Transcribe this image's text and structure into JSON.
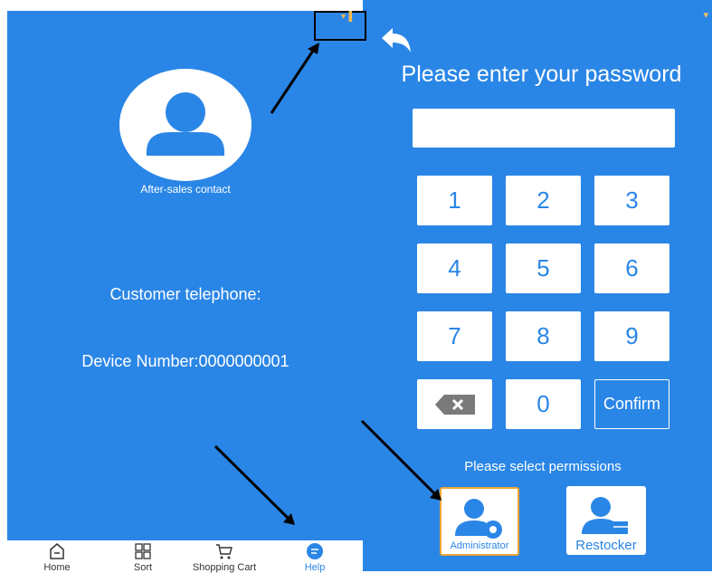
{
  "left": {
    "contact_label": "After-sales contact",
    "telephone_label": "Customer telephone:",
    "device_label": "Device Number:0000000001"
  },
  "right": {
    "title": "Please enter your password",
    "password_value": "",
    "keys": [
      "1",
      "2",
      "3",
      "4",
      "5",
      "6",
      "7",
      "8",
      "9",
      "0"
    ],
    "confirm_label": "Confirm",
    "permissions_title": "Please select permissions",
    "admin_label": "Administrator",
    "restocker_label": "Restocker"
  },
  "nav": {
    "home": "Home",
    "sort": "Sort",
    "cart": "Shopping Cart",
    "help": "Help"
  },
  "colors": {
    "background": "#2a86e6",
    "accent": "#2a86e6",
    "highlight_border": "#f0a534"
  }
}
